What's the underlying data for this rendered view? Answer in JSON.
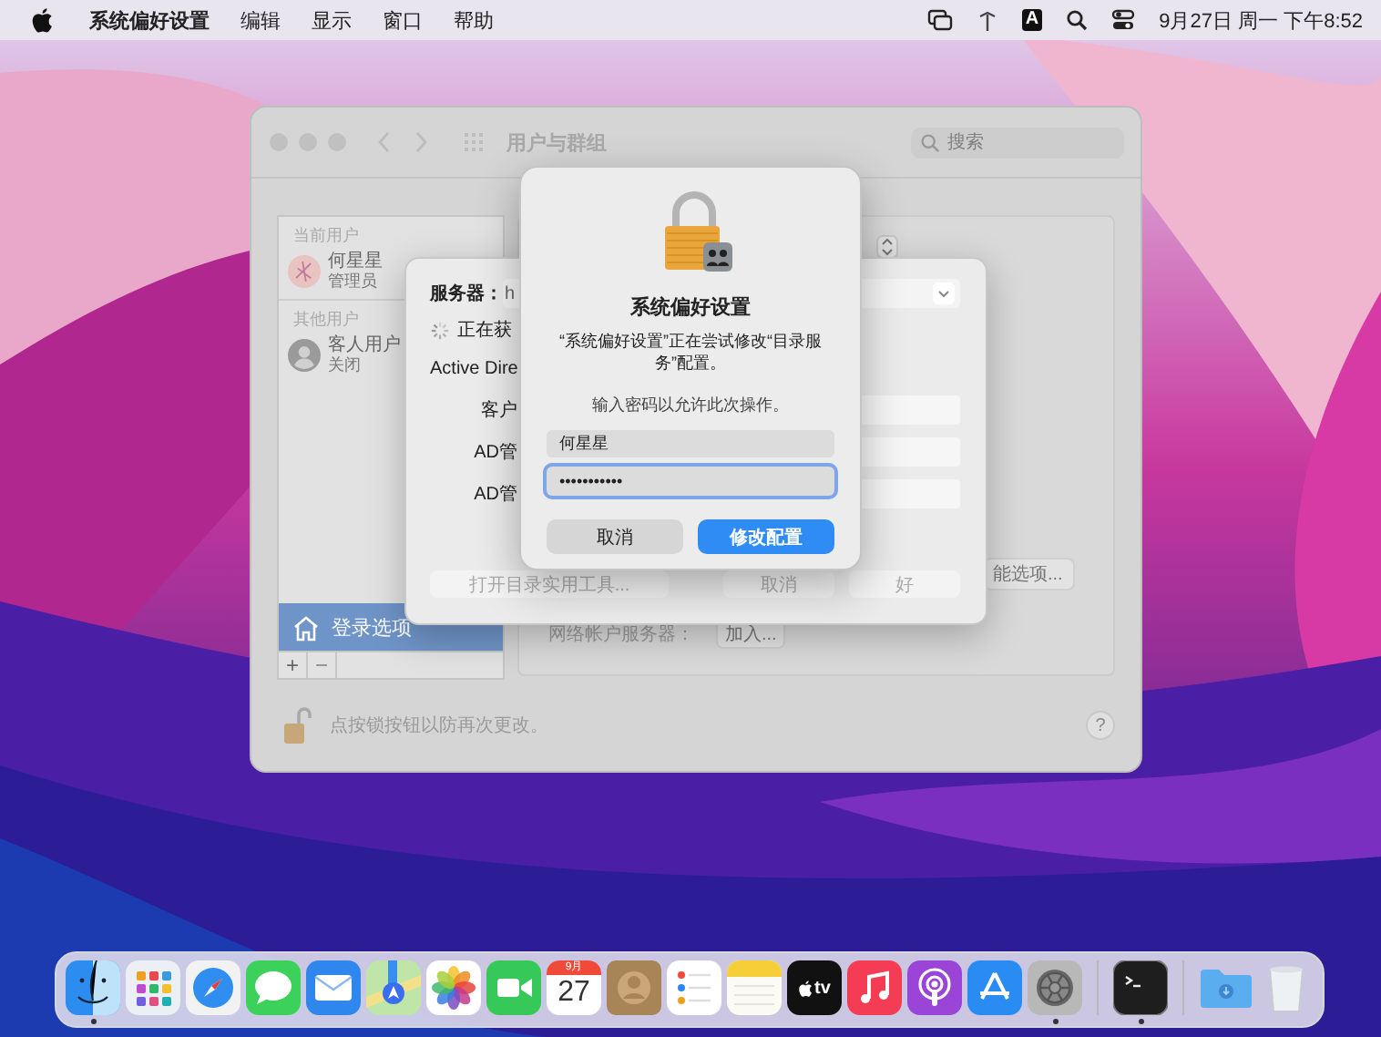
{
  "menu_bar": {
    "app_name": "系统偏好设置",
    "menus": [
      "编辑",
      "显示",
      "窗口",
      "帮助"
    ],
    "input_source": "A",
    "clock": "9月27日 周一 下午8:52"
  },
  "window": {
    "title": "用户与群组",
    "search": {
      "placeholder": "搜索"
    },
    "sidebar": {
      "sections": [
        {
          "header": "当前用户",
          "users": [
            {
              "name": "何星星",
              "role": "管理员",
              "kind": "drawing",
              "selected": false
            }
          ]
        },
        {
          "header": "其他用户",
          "users": [
            {
              "name": "客人用户",
              "role": "关闭",
              "kind": "silhouette",
              "selected": false
            }
          ]
        }
      ],
      "login_options": {
        "label": "登录选项",
        "selected": true
      },
      "add_button": "+",
      "remove_button": "−"
    },
    "panel": {
      "options_button": "能选项...",
      "network_server_label": "网络帐户服务器：",
      "join_button": "加入..."
    },
    "lock_note": "点按锁按钮以防再次更改。",
    "help_button": "?"
  },
  "directory_sheet": {
    "server_label": "服务器：",
    "server_value": "h",
    "status": "正在获",
    "section": "Active Dire",
    "fields": [
      {
        "label": "客户"
      },
      {
        "label": "AD管"
      },
      {
        "label": "AD管"
      }
    ],
    "buttons": [
      {
        "label": "打开目录实用工具...",
        "disabled": true
      },
      {
        "label": "取消",
        "disabled": true
      },
      {
        "label": "好",
        "disabled": true
      }
    ]
  },
  "auth_dialog": {
    "title": "系统偏好设置",
    "message": "“系统偏好设置”正在尝试修改“目录服务”配置。",
    "prompt": "输入密码以允许此次操作。",
    "username": "何星星",
    "password": "•••••••••••",
    "password_focused": true,
    "cancel_button": "取消",
    "confirm_button": "修改配置"
  },
  "dock": {
    "sections": [
      {
        "items": [
          {
            "kind": "finder",
            "running": true
          },
          {
            "kind": "launchpad",
            "running": false
          },
          {
            "kind": "safari",
            "running": false
          },
          {
            "kind": "messages",
            "running": false
          },
          {
            "kind": "mail",
            "running": false
          },
          {
            "kind": "maps",
            "running": false
          },
          {
            "kind": "photos",
            "running": false
          },
          {
            "kind": "facetime",
            "running": false
          },
          {
            "kind": "calendar",
            "running": false,
            "month": "9月",
            "day": "27"
          },
          {
            "kind": "contacts",
            "running": false
          },
          {
            "kind": "reminders",
            "running": false
          },
          {
            "kind": "notes",
            "running": false
          },
          {
            "kind": "tv",
            "running": false,
            "label": "tv"
          },
          {
            "kind": "music",
            "running": false
          },
          {
            "kind": "podcasts",
            "running": false
          },
          {
            "kind": "appstore",
            "running": false
          },
          {
            "kind": "settings",
            "running": true
          }
        ]
      },
      {
        "items": [
          {
            "kind": "terminal",
            "running": true
          }
        ]
      },
      {
        "items": [
          {
            "kind": "downloads",
            "running": false
          },
          {
            "kind": "trash",
            "running": false
          }
        ]
      }
    ]
  }
}
